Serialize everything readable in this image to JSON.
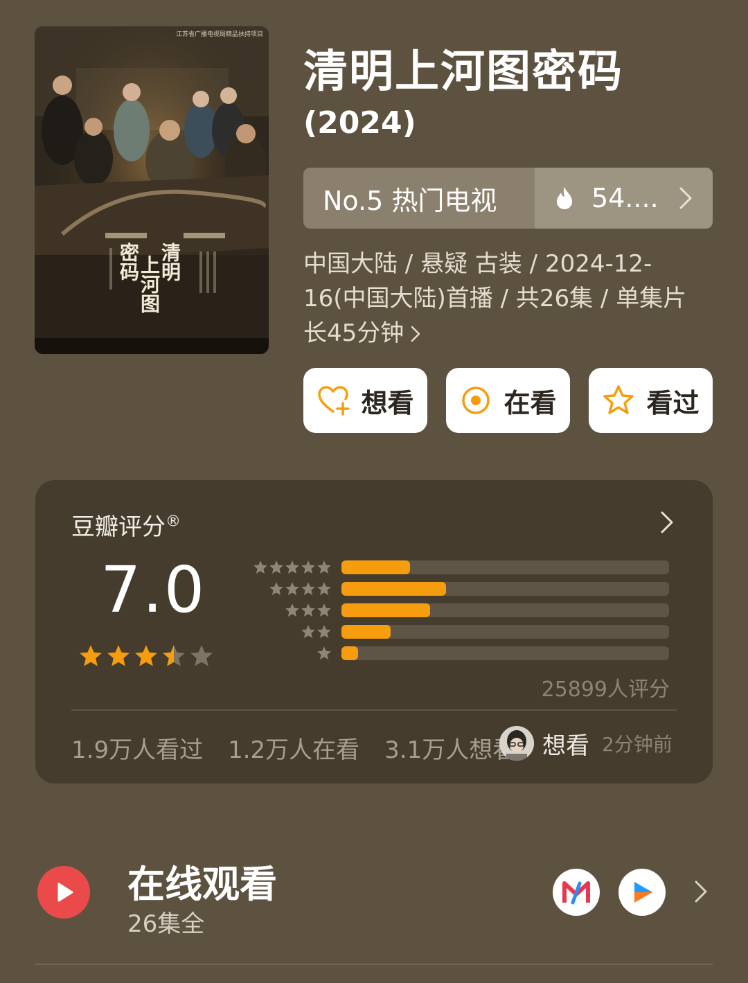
{
  "poster": {
    "top_text": "江苏省广播电视局精品扶持项目",
    "title_chars": [
      "清明",
      "上河图",
      "密码"
    ]
  },
  "show": {
    "title": "清明上河图密码",
    "year": "(2024)"
  },
  "rank": {
    "label": "No.5 热门电视",
    "heat": "54...."
  },
  "meta": {
    "text": "中国大陆 / 悬疑 古装 / 2024-12-16(中国大陆)首播 / 共26集 / 单集片长45分钟"
  },
  "actions": {
    "want": "想看",
    "watching": "在看",
    "watched": "看过"
  },
  "rating": {
    "label": "豆瓣评分",
    "registered": "®",
    "score": "7.0",
    "score_stars": 3.5,
    "distribution": [
      {
        "stars": 5,
        "fraction": 0.21
      },
      {
        "stars": 4,
        "fraction": 0.32
      },
      {
        "stars": 3,
        "fraction": 0.27
      },
      {
        "stars": 2,
        "fraction": 0.15
      },
      {
        "stars": 1,
        "fraction": 0.05
      }
    ],
    "count": "25899人评分",
    "stats": {
      "watched": "1.9万人看过",
      "watching": "1.2万人在看",
      "want": "3.1万人想看"
    },
    "activity": {
      "action": "想看",
      "time": "2分钟前"
    }
  },
  "watch": {
    "title": "在线观看",
    "subtitle": "26集全",
    "platforms": [
      "mgtv-icon",
      "youku-icon"
    ]
  },
  "colors": {
    "background": "#5d5240",
    "card": "#453c2d",
    "accent": "#f59d0f",
    "play": "#ea4a4a"
  }
}
